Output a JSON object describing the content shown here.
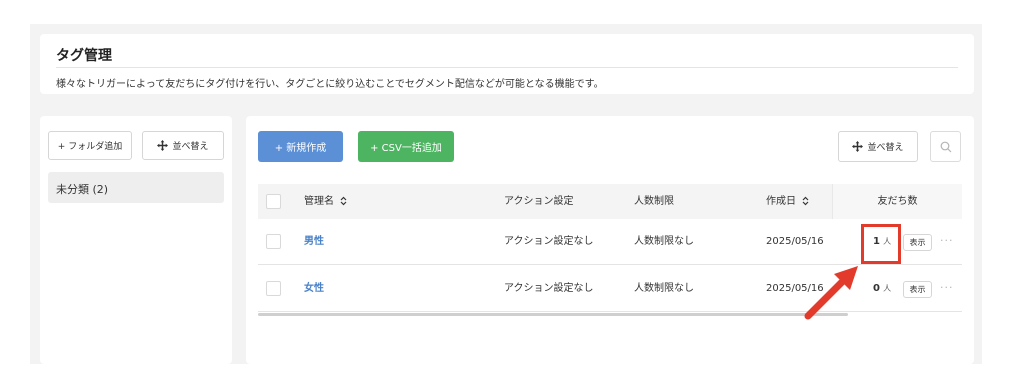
{
  "header": {
    "title": "タグ管理",
    "description": "様々なトリガーによって友だちにタグ付けを行い、タグごとに絞り込むことでセグメント配信などが可能となる機能です。"
  },
  "sidebar": {
    "add_folder_label": "+ フォルダ追加",
    "sort_label": "並べ替え",
    "folders": [
      {
        "label": "未分類 (2)"
      }
    ]
  },
  "toolbar": {
    "new_label": "+ 新規作成",
    "csv_label": "+ CSV一括追加",
    "sort_label": "並べ替え"
  },
  "table": {
    "columns": {
      "name": "管理名",
      "action": "アクション設定",
      "limit": "人数制限",
      "created": "作成日",
      "friends": "友だち数"
    },
    "rows": [
      {
        "name": "男性",
        "action": "アクション設定なし",
        "limit": "人数制限なし",
        "created": "2025/05/16",
        "count": "1",
        "unit": "人",
        "show_label": "表示",
        "more": "···"
      },
      {
        "name": "女性",
        "action": "アクション設定なし",
        "limit": "人数制限なし",
        "created": "2025/05/16",
        "count": "0",
        "unit": "人",
        "show_label": "表示",
        "more": "···"
      }
    ]
  },
  "colors": {
    "primary_blue": "#5b8fd6",
    "success_green": "#4db461",
    "link_blue": "#4a82c8",
    "annotation_red": "#e23b2c"
  },
  "icons": [
    "move-icon",
    "search-icon",
    "sort-icon",
    "arrow-icon"
  ]
}
